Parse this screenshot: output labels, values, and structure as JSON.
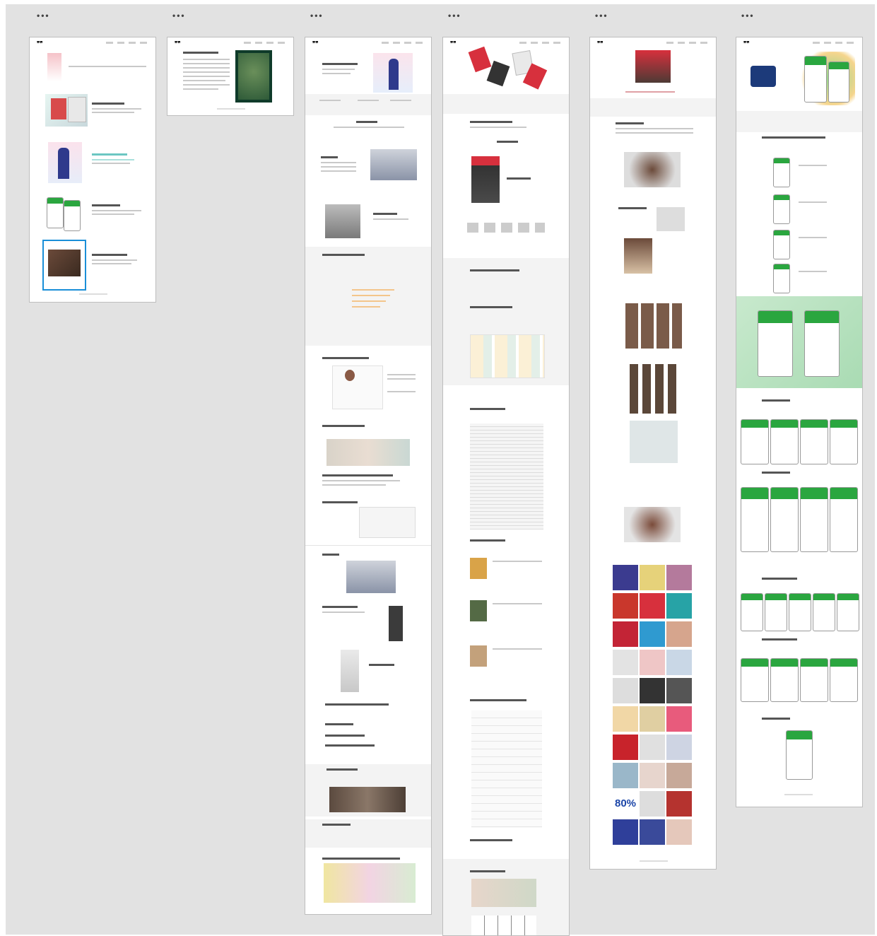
{
  "toolbar": {
    "more_icon": "•••"
  },
  "artboards": [
    {
      "id": "home",
      "menu": "•••"
    },
    {
      "id": "about",
      "menu": "•••"
    },
    {
      "id": "case-aic",
      "menu": "•••"
    },
    {
      "id": "case-journey",
      "menu": "•••"
    },
    {
      "id": "case-foodie",
      "menu": "•••"
    },
    {
      "id": "case-fantasy",
      "menu": "•••"
    }
  ],
  "branding": {
    "logo_glyph": "❞❞"
  },
  "visible_text": {
    "big_percent": "80%"
  },
  "colors": {
    "canvas": "#e2e2e2",
    "selection": "#1a8fd8",
    "accent_green": "#2aa63f",
    "accent_red": "#d7303d"
  }
}
